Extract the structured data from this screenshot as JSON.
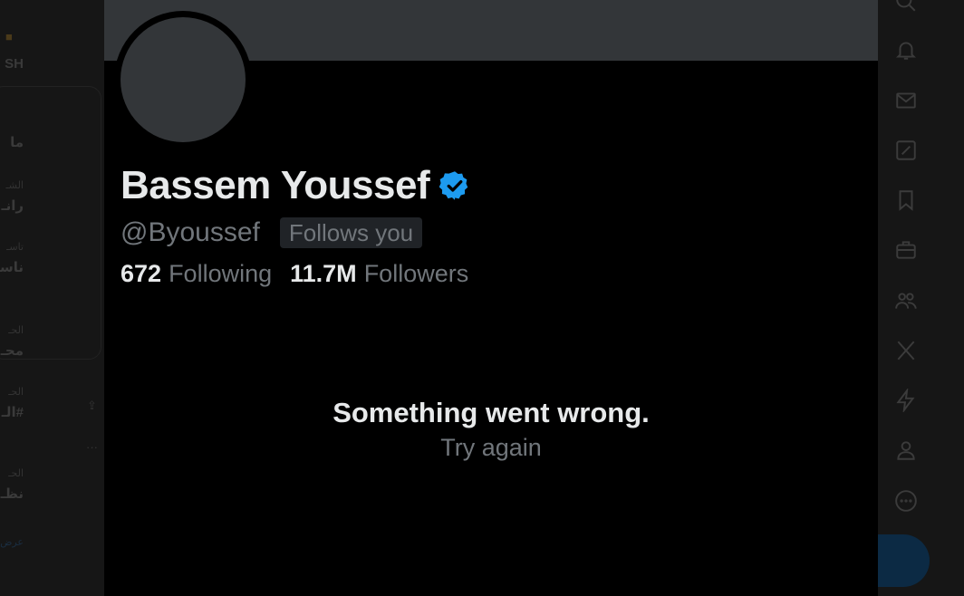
{
  "profile": {
    "name": "Bassem Youssef",
    "handle": "@Byoussef",
    "follows_you": "Follows you",
    "following_count": "672",
    "following_label": "Following",
    "followers_count": "11.7M",
    "followers_label": "Followers"
  },
  "error": {
    "title": "Something went wrong.",
    "retry": "Try again"
  },
  "colors": {
    "verified": "#1d9bf0",
    "banner": "#333639",
    "modal_bg": "#000000"
  },
  "background_nav_icons": [
    "search-icon",
    "bell-icon",
    "mail-icon",
    "compose-icon",
    "bookmark-icon",
    "briefcase-icon",
    "communities-icon",
    "x-logo-icon",
    "lightning-icon",
    "profile-icon",
    "more-icon"
  ]
}
